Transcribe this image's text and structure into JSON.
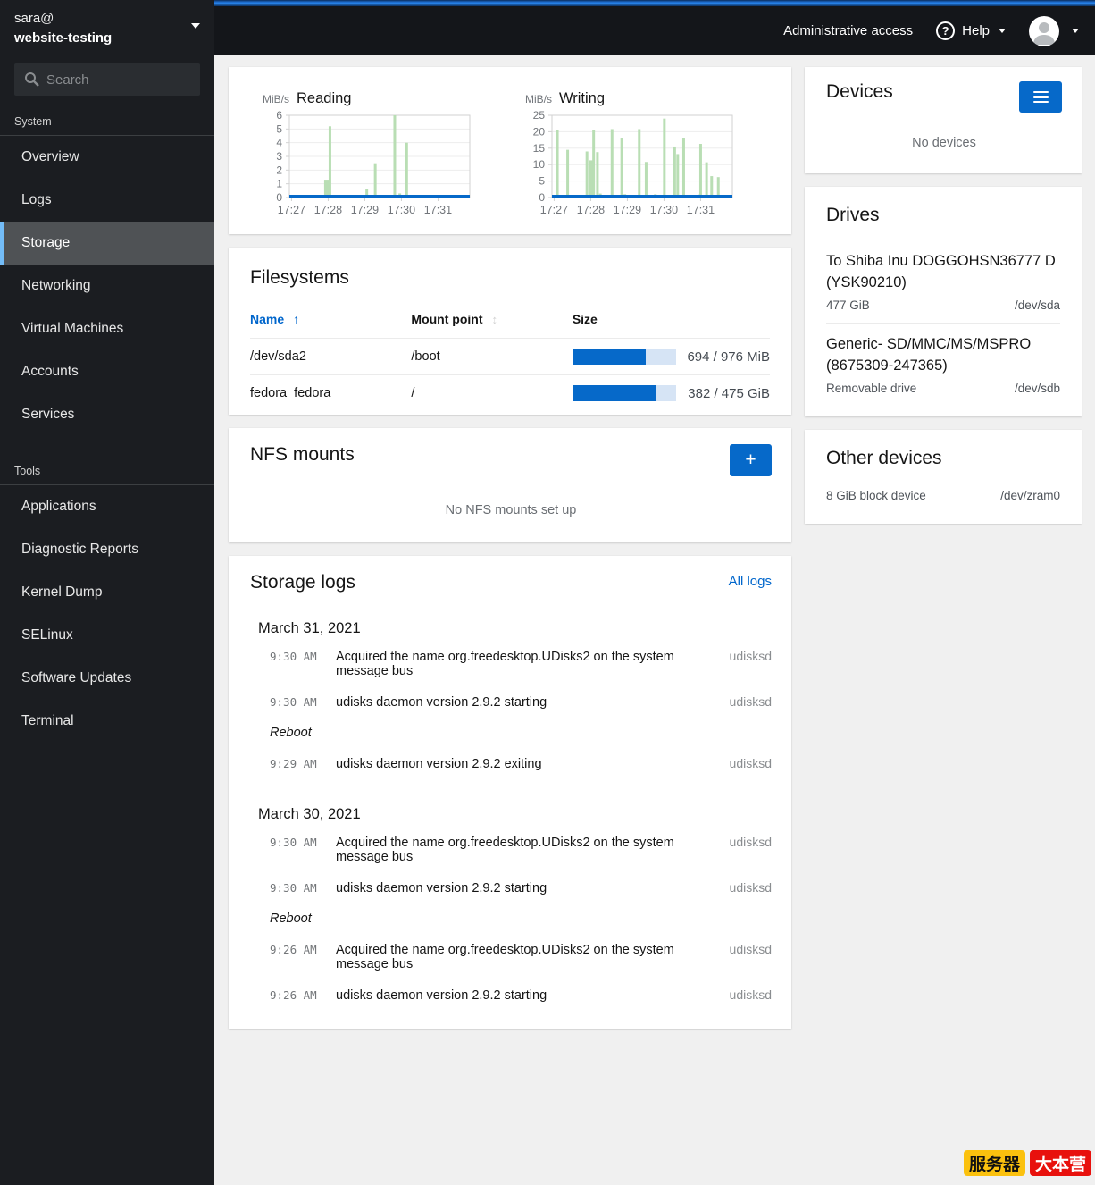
{
  "masthead": {
    "admin_access": "Administrative access",
    "help_label": "Help",
    "help_icon": "?"
  },
  "sidebar": {
    "user": "sara@",
    "host": "website-testing",
    "search_placeholder": "Search",
    "sections": [
      {
        "label": "System",
        "items": [
          {
            "label": "Overview",
            "active": false
          },
          {
            "label": "Logs",
            "active": false
          },
          {
            "label": "Storage",
            "active": true
          },
          {
            "label": "Networking",
            "active": false
          },
          {
            "label": "Virtual Machines",
            "active": false
          },
          {
            "label": "Accounts",
            "active": false
          },
          {
            "label": "Services",
            "active": false
          }
        ]
      },
      {
        "label": "Tools",
        "items": [
          {
            "label": "Applications"
          },
          {
            "label": "Diagnostic Reports"
          },
          {
            "label": "Kernel Dump"
          },
          {
            "label": "SELinux"
          },
          {
            "label": "Software Updates"
          },
          {
            "label": "Terminal"
          }
        ]
      }
    ]
  },
  "chart_data": [
    {
      "type": "bar",
      "title": "Reading",
      "unit": "MiB/s",
      "ylim": [
        0,
        6
      ],
      "yticks": [
        0,
        1,
        2,
        3,
        4,
        5,
        6
      ],
      "xticks": [
        {
          "label": "17:27",
          "pos": 0.012
        },
        {
          "label": "17:28",
          "pos": 0.215
        },
        {
          "label": "17:29",
          "pos": 0.418
        },
        {
          "label": "17:30",
          "pos": 0.621
        },
        {
          "label": "17:31",
          "pos": 0.824
        }
      ],
      "bar_color": "#b9deb4",
      "baseline_color": "#0669c9",
      "bars": [
        {
          "x": 0.21,
          "v": 1.3,
          "w": 7
        },
        {
          "x": 0.225,
          "v": 5.2,
          "w": 3
        },
        {
          "x": 0.327,
          "v": 0.15,
          "w": 4
        },
        {
          "x": 0.429,
          "v": 0.65,
          "w": 3
        },
        {
          "x": 0.476,
          "v": 2.5,
          "w": 3
        },
        {
          "x": 0.584,
          "v": 6.0,
          "w": 3
        },
        {
          "x": 0.612,
          "v": 0.3,
          "w": 3
        },
        {
          "x": 0.65,
          "v": 4.0,
          "w": 3
        }
      ]
    },
    {
      "type": "bar",
      "title": "Writing",
      "unit": "MiB/s",
      "ylim": [
        0,
        25
      ],
      "yticks": [
        0,
        5,
        10,
        15,
        20,
        25
      ],
      "xticks": [
        {
          "label": "17:27",
          "pos": 0.012
        },
        {
          "label": "17:28",
          "pos": 0.215
        },
        {
          "label": "17:29",
          "pos": 0.418
        },
        {
          "label": "17:30",
          "pos": 0.621
        },
        {
          "label": "17:31",
          "pos": 0.824
        }
      ],
      "bar_color": "#b9deb4",
      "baseline_color": "#0669c9",
      "bars": [
        {
          "x": 0.03,
          "v": 20.5,
          "w": 3
        },
        {
          "x": 0.087,
          "v": 14.5,
          "w": 3
        },
        {
          "x": 0.194,
          "v": 14.0,
          "w": 3
        },
        {
          "x": 0.217,
          "v": 11.3,
          "w": 4
        },
        {
          "x": 0.231,
          "v": 20.5,
          "w": 3
        },
        {
          "x": 0.252,
          "v": 13.8,
          "w": 3
        },
        {
          "x": 0.268,
          "v": 1.2,
          "w": 3
        },
        {
          "x": 0.28,
          "v": 0.8,
          "w": 3
        },
        {
          "x": 0.333,
          "v": 20.8,
          "w": 3
        },
        {
          "x": 0.387,
          "v": 18.2,
          "w": 3
        },
        {
          "x": 0.404,
          "v": 1.0,
          "w": 3
        },
        {
          "x": 0.443,
          "v": 0.7,
          "w": 3
        },
        {
          "x": 0.484,
          "v": 20.8,
          "w": 3
        },
        {
          "x": 0.522,
          "v": 10.8,
          "w": 3
        },
        {
          "x": 0.573,
          "v": 1.0,
          "w": 3
        },
        {
          "x": 0.623,
          "v": 24.0,
          "w": 3
        },
        {
          "x": 0.68,
          "v": 15.5,
          "w": 3
        },
        {
          "x": 0.697,
          "v": 13.2,
          "w": 3
        },
        {
          "x": 0.73,
          "v": 18.2,
          "w": 3
        },
        {
          "x": 0.746,
          "v": 0.8,
          "w": 2
        },
        {
          "x": 0.815,
          "v": 0.9,
          "w": 2
        },
        {
          "x": 0.824,
          "v": 16.3,
          "w": 3
        },
        {
          "x": 0.857,
          "v": 10.7,
          "w": 3
        },
        {
          "x": 0.885,
          "v": 6.5,
          "w": 3
        },
        {
          "x": 0.922,
          "v": 6.2,
          "w": 3
        }
      ]
    }
  ],
  "filesystems": {
    "title": "Filesystems",
    "headers": {
      "name": "Name",
      "mount": "Mount point",
      "size": "Size"
    },
    "sort_arrow": "↑",
    "sort_idle": "↕",
    "rows": [
      {
        "name": "/dev/sda2",
        "mount": "/boot",
        "size_label": "694 / 976 MiB",
        "pct": 71.1
      },
      {
        "name": "fedora_fedora",
        "mount": "/",
        "size_label": "382 / 475 GiB",
        "pct": 80.4
      }
    ]
  },
  "nfs": {
    "title": "NFS mounts",
    "add_label": "+",
    "empty": "No NFS mounts set up"
  },
  "storage_logs": {
    "title": "Storage logs",
    "all_logs": "All logs",
    "groups": [
      {
        "date": "March 31, 2021",
        "entries": [
          {
            "time": "9:30 AM",
            "message": "Acquired the name org.freedesktop.UDisks2 on the system message bus",
            "service": "udisksd"
          },
          {
            "time": "9:30 AM",
            "message": "udisks daemon version 2.9.2 starting",
            "service": "udisksd"
          },
          {
            "label": "Reboot"
          },
          {
            "time": "9:29 AM",
            "message": "udisks daemon version 2.9.2 exiting",
            "service": "udisksd"
          }
        ]
      },
      {
        "date": "March 30, 2021",
        "entries": [
          {
            "time": "9:30 AM",
            "message": "Acquired the name org.freedesktop.UDisks2 on the system message bus",
            "service": "udisksd"
          },
          {
            "time": "9:30 AM",
            "message": "udisks daemon version 2.9.2 starting",
            "service": "udisksd"
          },
          {
            "label": "Reboot"
          },
          {
            "time": "9:26 AM",
            "message": "Acquired the name org.freedesktop.UDisks2 on the system message bus",
            "service": "udisksd"
          },
          {
            "time": "9:26 AM",
            "message": "udisks daemon version 2.9.2 starting",
            "service": "udisksd"
          }
        ]
      }
    ]
  },
  "devices": {
    "title": "Devices",
    "empty": "No devices"
  },
  "drives": {
    "title": "Drives",
    "items": [
      {
        "name": "To Shiba Inu DOGGOHSN36777 D (YSK90210)",
        "detail": "477 GiB",
        "path": "/dev/sda"
      },
      {
        "name": "Generic- SD/MMC/MS/MSPRO (8675309-247365)",
        "detail": "Removable drive",
        "path": "/dev/sdb"
      }
    ]
  },
  "other_devices": {
    "title": "Other devices",
    "items": [
      {
        "detail": "8 GiB block device",
        "path": "/dev/zram0"
      }
    ]
  },
  "watermark": {
    "badge1": "服务器",
    "badge2": "大本营"
  },
  "colors": {
    "accent_blue": "#0066cc",
    "active_nav_bg": "#4f5255",
    "active_nav_border": "#73bcf7",
    "chart_green": "#b9deb4",
    "progress_fill": "#0669c9",
    "progress_track": "#d6e4f5"
  }
}
